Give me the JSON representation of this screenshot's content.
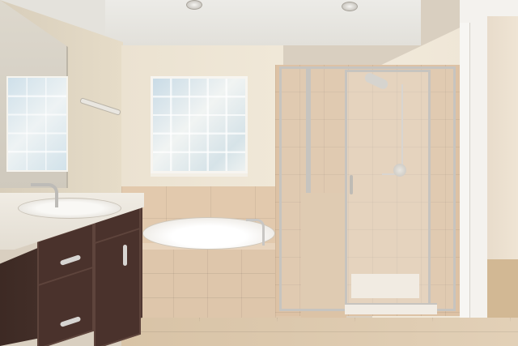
{
  "scene": {
    "objects": [
      "ceiling-light-icon",
      "window-icon",
      "bathtub-icon",
      "shower-icon",
      "sink-icon",
      "faucet-icon",
      "towel-bar-icon",
      "mirror-icon",
      "cabinet-icon",
      "door-icon"
    ],
    "colors": {
      "wall": "#ebe2d1",
      "tile": "#dec6ab",
      "cabinet": "#4a322c",
      "fixture": "#c7c4bf",
      "countertop": "#f0ece4"
    }
  }
}
